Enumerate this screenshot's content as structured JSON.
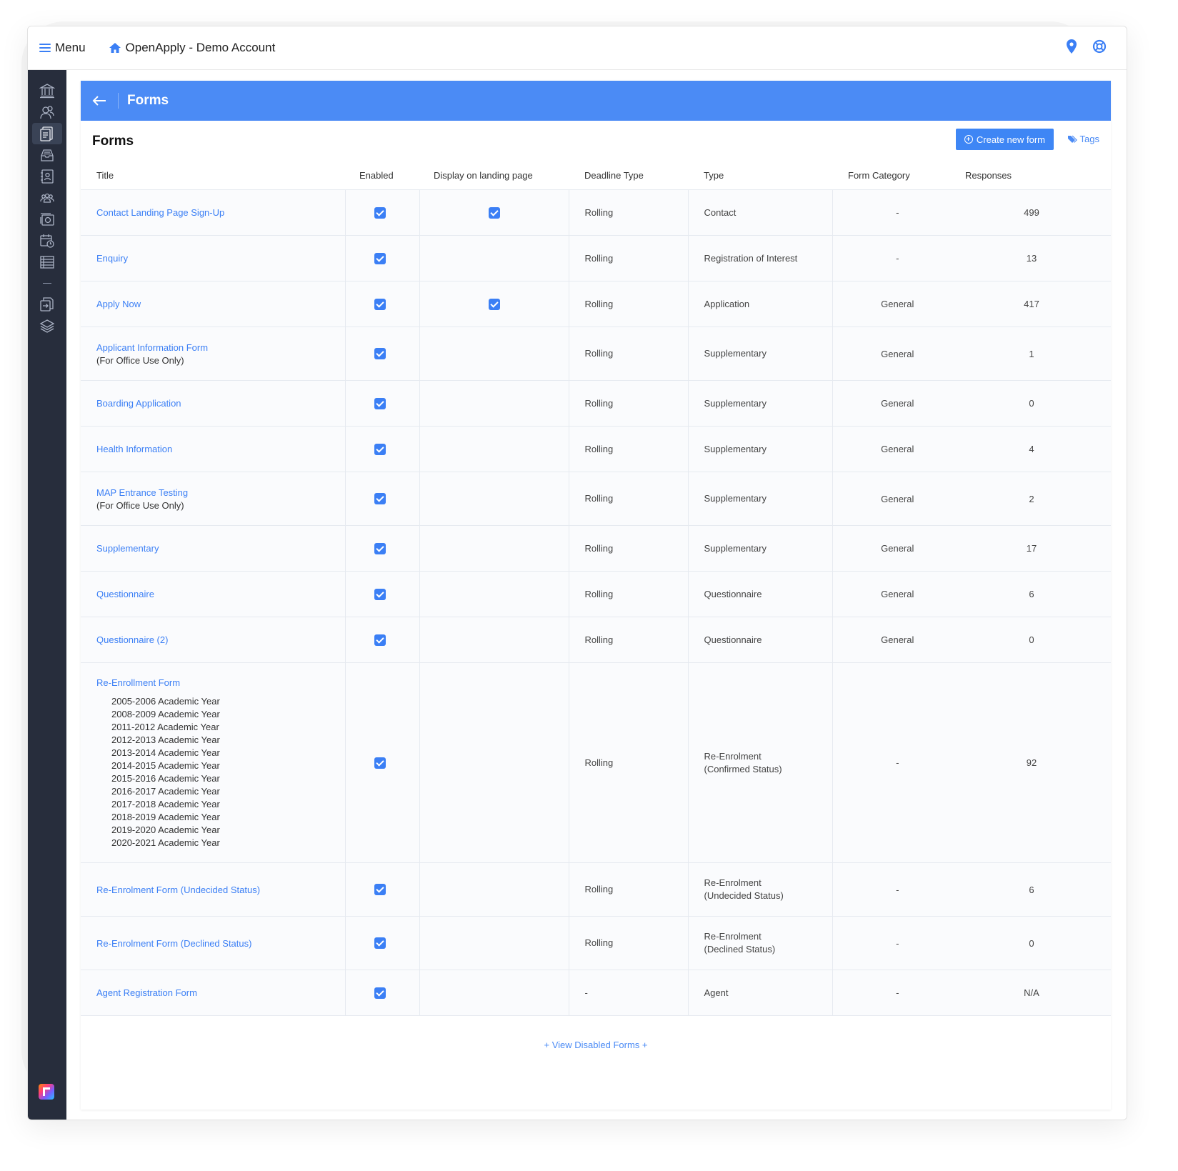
{
  "topbar": {
    "menu_label": "Menu",
    "app_title": "OpenApply - Demo Account"
  },
  "page": {
    "header_title": "Forms",
    "card_title": "Forms",
    "create_button": "Create new form",
    "tags_link": "Tags",
    "view_disabled": "+ View Disabled Forms +"
  },
  "colors": {
    "accent": "#4b8bf5",
    "sidebar": "#272d3c"
  },
  "sidebar_icons": [
    "institution-icon",
    "contacts-icon",
    "forms-icon",
    "inbox-icon",
    "contact-book-icon",
    "groups-icon",
    "camera-icon",
    "calendar-icon",
    "list-icon",
    "separator",
    "export-icon",
    "layers-icon"
  ],
  "table": {
    "columns": [
      "Title",
      "Enabled",
      "Display on landing page",
      "Deadline Type",
      "Type",
      "Form Category",
      "Responses"
    ],
    "rows": [
      {
        "title": "Contact Landing Page Sign-Up",
        "note": "",
        "enabled": true,
        "landing": true,
        "deadline": "Rolling",
        "type": "Contact",
        "type2": "",
        "category": "-",
        "responses": "499"
      },
      {
        "title": "Enquiry",
        "note": "",
        "enabled": true,
        "landing": false,
        "deadline": "Rolling",
        "type": "Registration of Interest",
        "type2": "",
        "category": "-",
        "responses": "13"
      },
      {
        "title": "Apply Now",
        "note": "",
        "enabled": true,
        "landing": true,
        "deadline": "Rolling",
        "type": "Application",
        "type2": "",
        "category": "General",
        "responses": "417"
      },
      {
        "title": "Applicant Information Form",
        "note": "(For Office Use Only)",
        "enabled": true,
        "landing": false,
        "deadline": "Rolling",
        "type": "Supplementary",
        "type2": "",
        "category": "General",
        "responses": "1"
      },
      {
        "title": "Boarding Application",
        "note": "",
        "enabled": true,
        "landing": false,
        "deadline": "Rolling",
        "type": "Supplementary",
        "type2": "",
        "category": "General",
        "responses": "0"
      },
      {
        "title": "Health Information",
        "note": "",
        "enabled": true,
        "landing": false,
        "deadline": "Rolling",
        "type": "Supplementary",
        "type2": "",
        "category": "General",
        "responses": "4"
      },
      {
        "title": "MAP Entrance Testing",
        "note": "(For Office Use Only)",
        "enabled": true,
        "landing": false,
        "deadline": "Rolling",
        "type": "Supplementary",
        "type2": "",
        "category": "General",
        "responses": "2"
      },
      {
        "title": "Supplementary",
        "note": "",
        "enabled": true,
        "landing": false,
        "deadline": "Rolling",
        "type": "Supplementary",
        "type2": "",
        "category": "General",
        "responses": "17"
      },
      {
        "title": "Questionnaire",
        "note": "",
        "enabled": true,
        "landing": false,
        "deadline": "Rolling",
        "type": "Questionnaire",
        "type2": "",
        "category": "General",
        "responses": "6"
      },
      {
        "title": "Questionnaire (2)",
        "note": "",
        "enabled": true,
        "landing": false,
        "deadline": "Rolling",
        "type": "Questionnaire",
        "type2": "",
        "category": "General",
        "responses": "0"
      },
      {
        "title": "Re-Enrollment Form",
        "note": "",
        "years": [
          "2005-2006 Academic Year",
          "2008-2009 Academic Year",
          "2011-2012 Academic Year",
          "2012-2013 Academic Year",
          "2013-2014 Academic Year",
          "2014-2015 Academic Year",
          "2015-2016 Academic Year",
          "2016-2017 Academic Year",
          "2017-2018 Academic Year",
          "2018-2019 Academic Year",
          "2019-2020 Academic Year",
          "2020-2021 Academic Year"
        ],
        "enabled": true,
        "landing": false,
        "deadline": "Rolling",
        "type": "Re-Enrolment",
        "type2": "(Confirmed Status)",
        "category": "-",
        "responses": "92"
      },
      {
        "title": "Re-Enrolment Form (Undecided Status)",
        "note": "",
        "enabled": true,
        "landing": false,
        "deadline": "Rolling",
        "type": "Re-Enrolment",
        "type2": "(Undecided Status)",
        "category": "-",
        "responses": "6"
      },
      {
        "title": "Re-Enrolment Form (Declined Status)",
        "note": "",
        "enabled": true,
        "landing": false,
        "deadline": "Rolling",
        "type": "Re-Enrolment",
        "type2": "(Declined Status)",
        "category": "-",
        "responses": "0"
      },
      {
        "title": "Agent Registration Form",
        "note": "",
        "enabled": true,
        "landing": false,
        "deadline": "-",
        "type": "Agent",
        "type2": "",
        "category": "-",
        "responses": "N/A"
      }
    ]
  }
}
